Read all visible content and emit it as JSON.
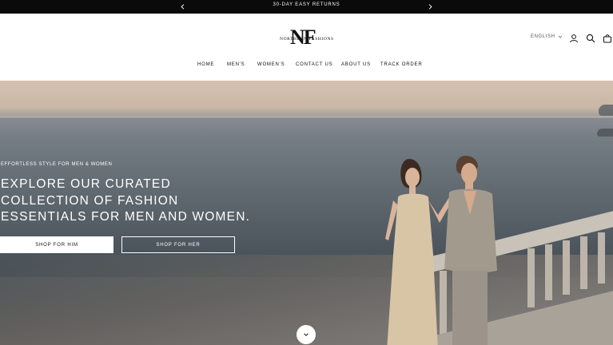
{
  "announcement": {
    "text": "30-DAY EASY RETURNS",
    "prev_icon": "chevron-left-icon",
    "next_icon": "chevron-right-icon"
  },
  "header": {
    "logo_monogram": "NF",
    "logo_wordmark": "NORTHERN FASHIONS",
    "language": "ENGLISH",
    "icons": [
      "account-icon",
      "search-icon",
      "cart-icon"
    ]
  },
  "nav": {
    "items": [
      "HOME",
      "MEN'S",
      "WOMEN'S",
      "CONTACT US",
      "ABOUT US",
      "TRACK ORDER"
    ]
  },
  "hero": {
    "eyebrow": "EFFORTLESS STYLE FOR MEN & WOMEN",
    "headline_lines": [
      "EXPLORE OUR CURATED",
      "COLLECTION OF FASHION",
      "ESSENTIALS FOR MEN AND WOMEN."
    ],
    "button_him": "SHOP FOR HIM",
    "button_her": "SHOP FOR HER",
    "scroll_icon": "chevron-down-icon"
  },
  "colors": {
    "announcement_bg": "#0a0a0a",
    "header_bg": "#ffffff",
    "text": "#111111",
    "hero_text": "#ffffff"
  }
}
